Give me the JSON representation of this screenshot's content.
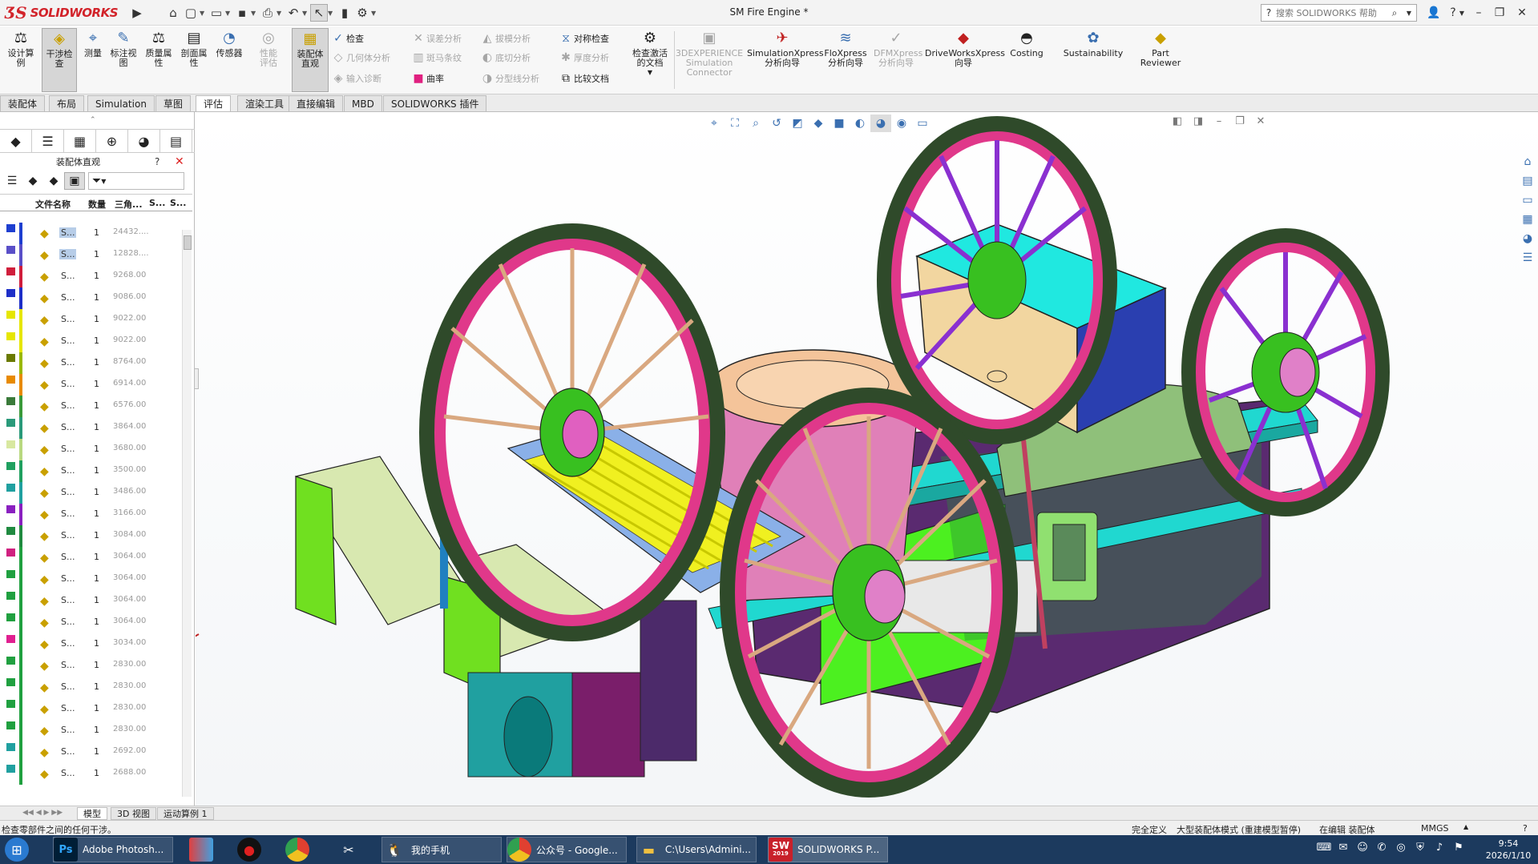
{
  "app": {
    "title": "SM Fire Engine *",
    "brand_ds": "ƷS",
    "brand_text": "SOLIDWORKS"
  },
  "help_search": {
    "placeholder": "搜索 SOLIDWORKS 帮助"
  },
  "tools": {
    "design_study": "设计算例",
    "interference": "干涉检查",
    "measure": "测量",
    "annotate": "标注视图",
    "mass_props": "质量属性",
    "section_props": "剖面属性",
    "sensors": "传感器",
    "perf_eval": "性能评估",
    "assembly_viz": "装配体直观",
    "check": "检查",
    "geometry": "几何体分析",
    "import_diag": "输入诊断",
    "draft_analysis": "误差分析",
    "zebra": "斑马条纹",
    "curvature": "曲率",
    "draft": "拔模分析",
    "undercut": "底切分析",
    "parting": "分型线分析",
    "symmetry": "对称检查",
    "thickness": "厚度分析",
    "compare": "比较文档",
    "check_active": "检查激活的文档",
    "sim_connector_1": "3DEXPERIENCE",
    "sim_connector_2": "Simulation",
    "sim_connector_3": "Connector",
    "simxpress": "SimulationXpress分析向导",
    "floxpress": "FloXpress分析向导",
    "dfmxpress": "DFMXpress分析向导",
    "driveworks": "DriveWorksXpress向导",
    "costing": "Costing",
    "sustainability": "Sustainability",
    "part_reviewer": "Part Reviewer"
  },
  "tabs": [
    "装配体",
    "布局",
    "Simulation",
    "草图",
    "评估",
    "渲染工具",
    "直接编辑",
    "MBD",
    "SOLIDWORKS 插件"
  ],
  "active_tab": "评估",
  "panel": {
    "title": "装配体直观",
    "columns": {
      "name": "文件名称",
      "qty": "数量",
      "tri": "三角...",
      "c4": "S...",
      "c5": "S..."
    },
    "rows": [
      {
        "name": "S...",
        "qty": "1",
        "tri": "24432....",
        "color": "#1e3fd0",
        "line": "#1e3fd0"
      },
      {
        "name": "S...",
        "qty": "1",
        "tri": "12828....",
        "color": "#5a4fc8",
        "line": "#5a4fc8"
      },
      {
        "name": "S...",
        "qty": "1",
        "tri": "9268.00",
        "color": "#d01e3c",
        "line": "#d01e3c"
      },
      {
        "name": "S...",
        "qty": "1",
        "tri": "9086.00",
        "color": "#1e2fc8",
        "line": "#1e2fc8"
      },
      {
        "name": "S...",
        "qty": "1",
        "tri": "9022.00",
        "color": "#e6e600",
        "line": "#e6e600"
      },
      {
        "name": "S...",
        "qty": "1",
        "tri": "9022.00",
        "color": "#e6e600",
        "line": "#e6e600"
      },
      {
        "name": "S...",
        "qty": "1",
        "tri": "8764.00",
        "color": "#6a7a00",
        "line": "#9ab800"
      },
      {
        "name": "S...",
        "qty": "1",
        "tri": "6914.00",
        "color": "#e88a00",
        "line": "#e88a00"
      },
      {
        "name": "S...",
        "qty": "1",
        "tri": "6576.00",
        "color": "#3a7a3a",
        "line": "#3a9a3a"
      },
      {
        "name": "S...",
        "qty": "1",
        "tri": "3864.00",
        "color": "#2a9a7a",
        "line": "#2a9a7a"
      },
      {
        "name": "S...",
        "qty": "1",
        "tri": "3680.00",
        "color": "#d8e8a0",
        "line": "#b8d880"
      },
      {
        "name": "S...",
        "qty": "1",
        "tri": "3500.00",
        "color": "#20a060",
        "line": "#20a060"
      },
      {
        "name": "S...",
        "qty": "1",
        "tri": "3486.00",
        "color": "#20a0a0",
        "line": "#20a0a0"
      },
      {
        "name": "S...",
        "qty": "1",
        "tri": "3166.00",
        "color": "#8a20c0",
        "line": "#8a20c0"
      },
      {
        "name": "S...",
        "qty": "1",
        "tri": "3084.00",
        "color": "#208a40",
        "line": "#208a40"
      },
      {
        "name": "S...",
        "qty": "1",
        "tri": "3064.00",
        "color": "#d02080",
        "line": "#20a040"
      },
      {
        "name": "S...",
        "qty": "1",
        "tri": "3064.00",
        "color": "#20a040",
        "line": "#20a040"
      },
      {
        "name": "S...",
        "qty": "1",
        "tri": "3064.00",
        "color": "#20a040",
        "line": "#20a040"
      },
      {
        "name": "S...",
        "qty": "1",
        "tri": "3064.00",
        "color": "#20a040",
        "line": "#20a040"
      },
      {
        "name": "S...",
        "qty": "1",
        "tri": "3034.00",
        "color": "#e02090",
        "line": "#20a040"
      },
      {
        "name": "S...",
        "qty": "1",
        "tri": "2830.00",
        "color": "#20a040",
        "line": "#20a040"
      },
      {
        "name": "S...",
        "qty": "1",
        "tri": "2830.00",
        "color": "#20a040",
        "line": "#20a040"
      },
      {
        "name": "S...",
        "qty": "1",
        "tri": "2830.00",
        "color": "#20a040",
        "line": "#20a040"
      },
      {
        "name": "S...",
        "qty": "1",
        "tri": "2830.00",
        "color": "#20a040",
        "line": "#20a040"
      },
      {
        "name": "S...",
        "qty": "1",
        "tri": "2692.00",
        "color": "#20a0a0",
        "line": "#20a040"
      },
      {
        "name": "S...",
        "qty": "1",
        "tri": "2688.00",
        "color": "#20a0a0",
        "line": "#20a040"
      }
    ]
  },
  "bottom_tabs": [
    "模型",
    "3D 视图",
    "运动算例 1"
  ],
  "status": {
    "left": "检查零部件之间的任何干涉。",
    "defined": "完全定义",
    "mode": "大型装配体模式 (重建模型暂停)",
    "editing": "在编辑 装配体",
    "units": "MMGS"
  },
  "taskbar": {
    "photoshop": "Adobe Photosh...",
    "phone": "我的手机",
    "chrome": "公众号 - Google...",
    "explorer": "C:\\Users\\Admini...",
    "solidworks": "SOLIDWORKS P...",
    "sw_year": "2019",
    "time": "9:54",
    "date": "2026/1/10"
  },
  "colors": {
    "wheel_pink": "#e0388a",
    "wheel_rim": "#2f4a2a",
    "hub_green": "#38c020",
    "box_cyan": "#20e8e0",
    "box_tan": "#f2d6a0",
    "box_blue": "#2a3fb0",
    "body_purple": "#5a2a70",
    "body_green": "#4cf020",
    "frame_cyan": "#20d8d0",
    "spoke_tan": "#d9a880",
    "tank_peach": "#f4c49a"
  }
}
